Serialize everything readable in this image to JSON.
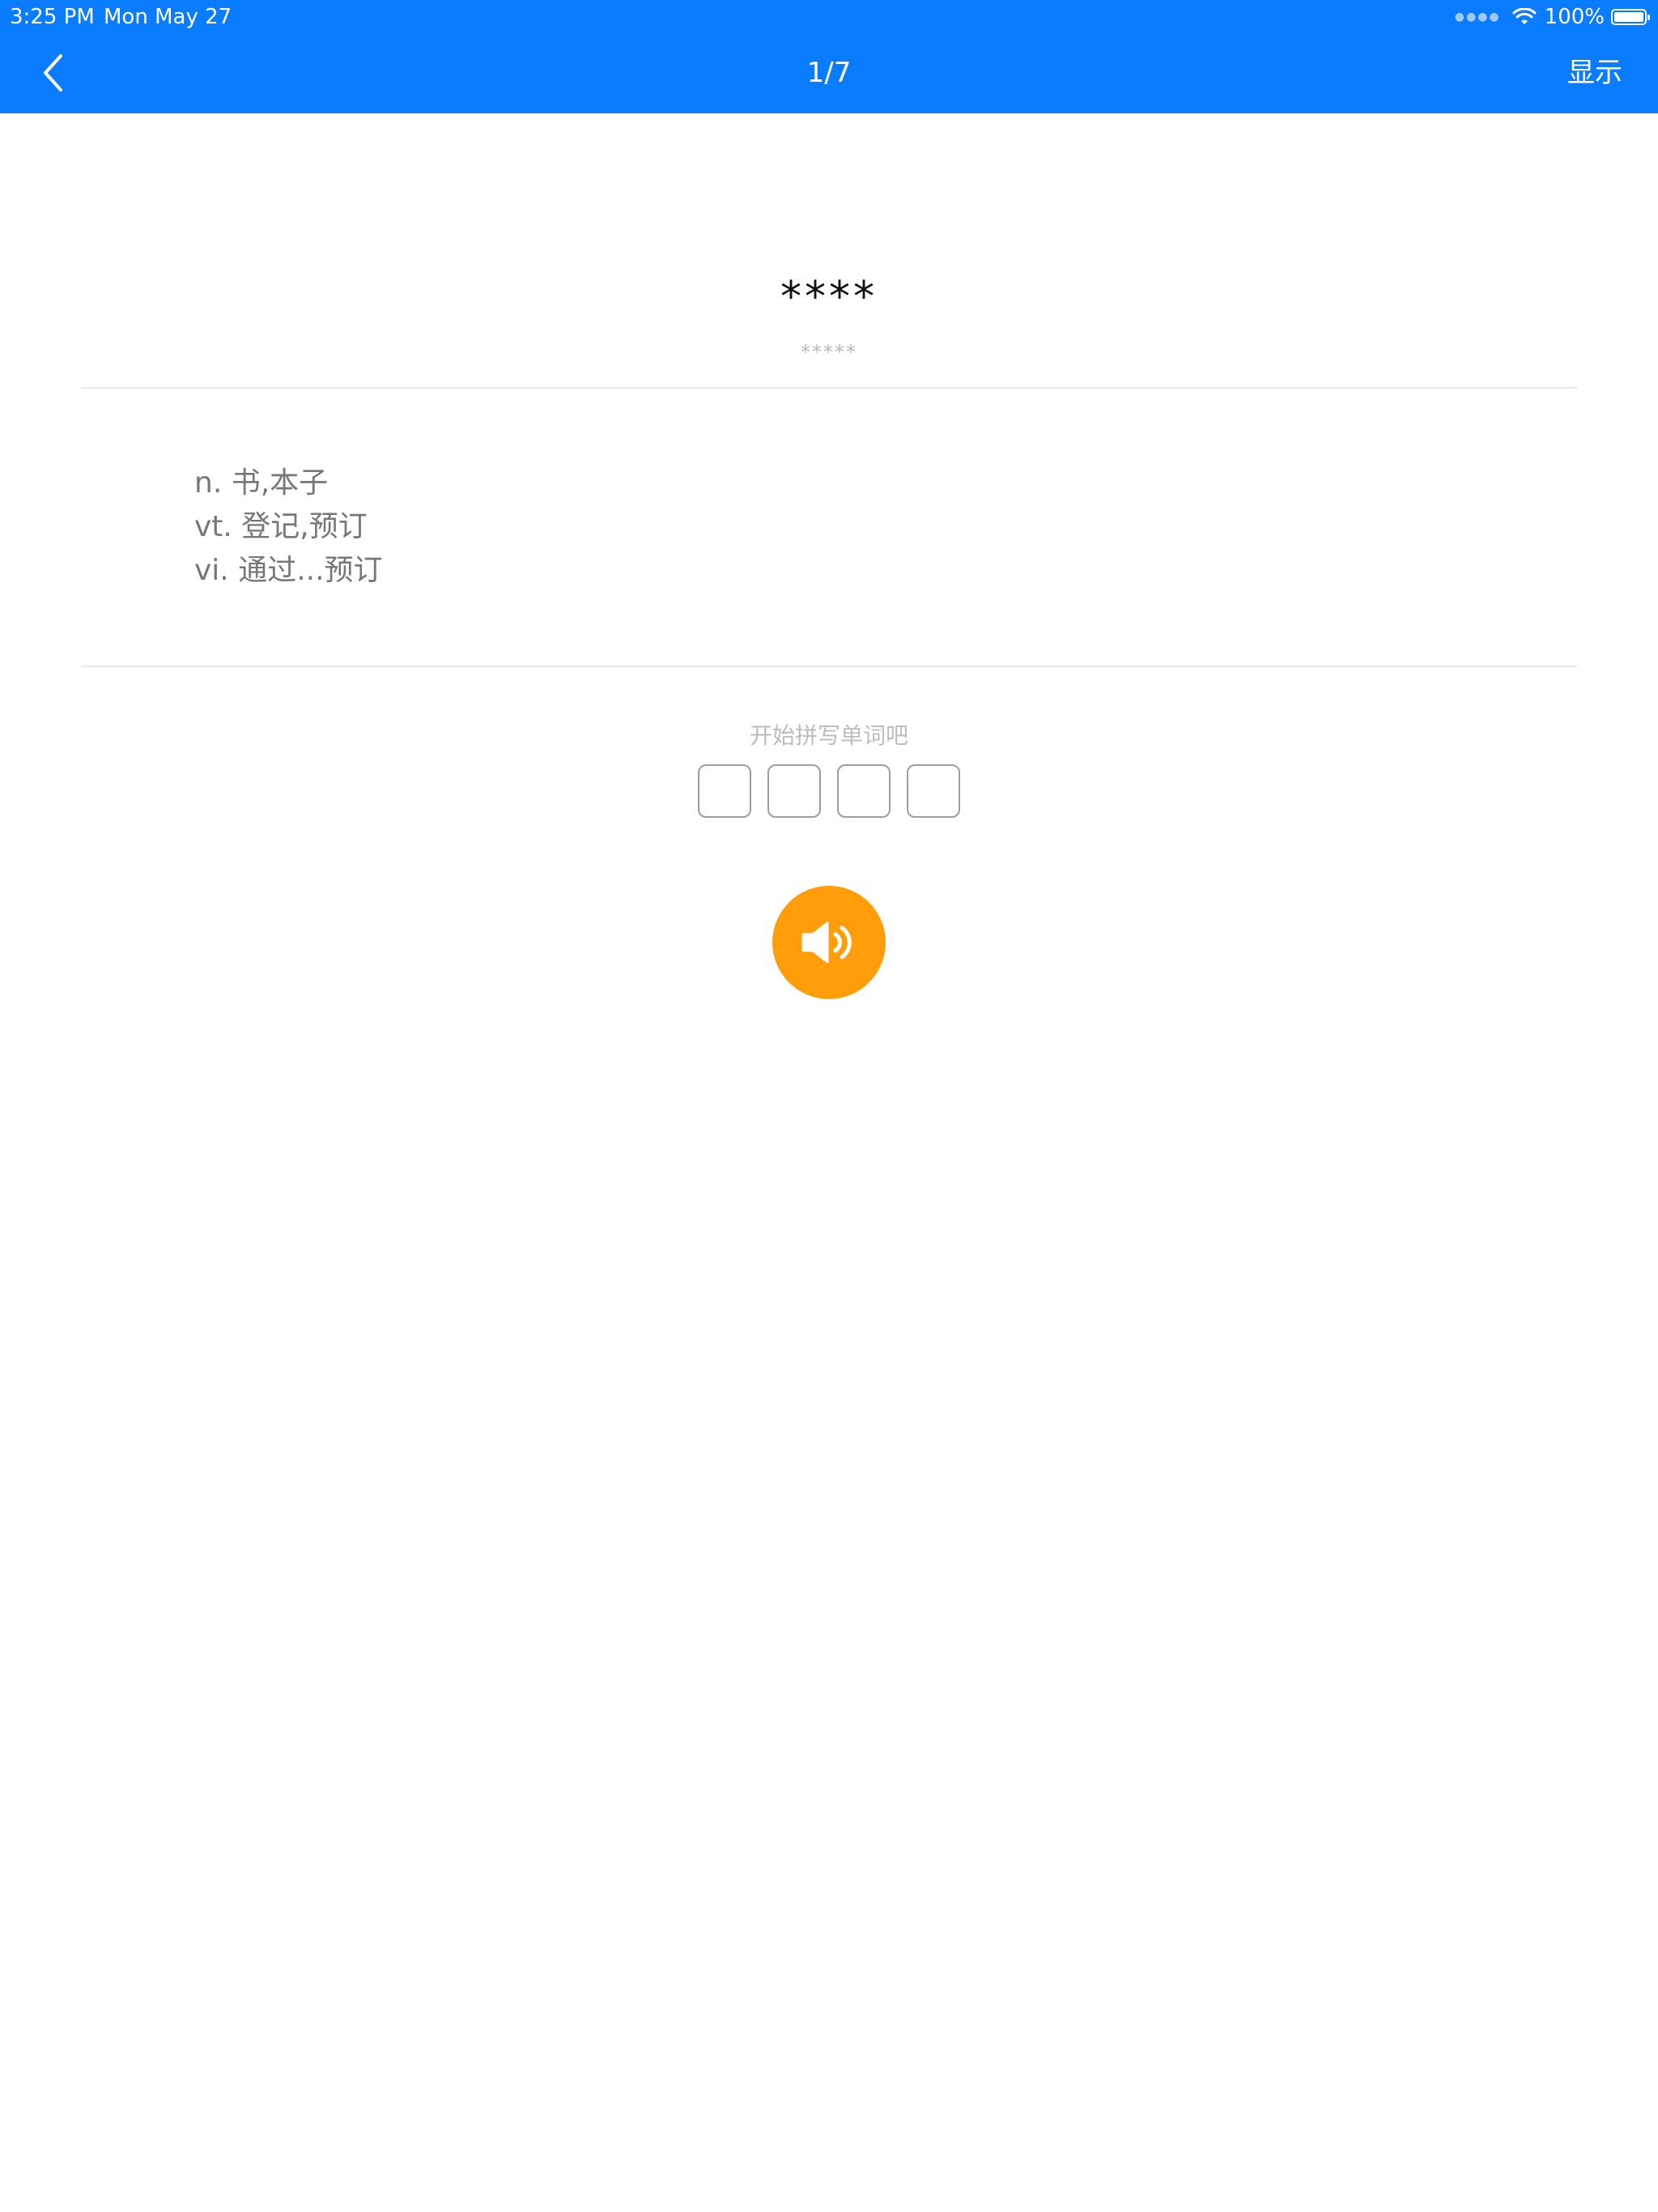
{
  "status_bar": {
    "time": "3:25 PM",
    "date": "Mon May 27",
    "battery": "100%"
  },
  "nav": {
    "back_icon": "chevron-left-icon",
    "title": "1/7",
    "show_label": "显示"
  },
  "word": {
    "mask": "****",
    "phonetic_mask": "*****"
  },
  "definitions": [
    "n. 书,本子",
    "vt. 登记,预订",
    "vi. 通过...预订"
  ],
  "spelling": {
    "hint": "开始拼写单词吧",
    "letter_count": 4
  },
  "speaker": {
    "icon": "speaker-volume-icon"
  },
  "colors": {
    "header": "#0a7cff",
    "speaker_button": "#ff9d0a"
  }
}
